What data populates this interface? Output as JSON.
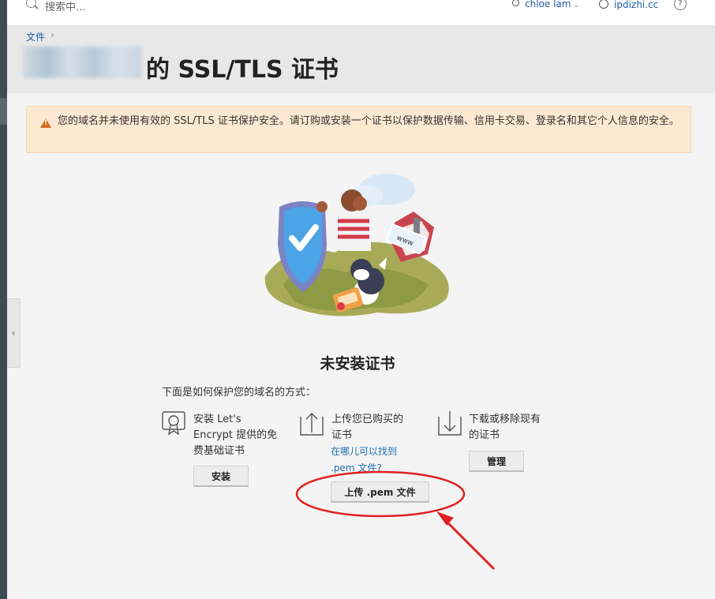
{
  "topbar": {
    "search_placeholder": "搜索中...",
    "user_name": "chloe lam",
    "domain_name": "ipdizhi.cc",
    "help_label": "?"
  },
  "breadcrumb": {
    "item": "文件",
    "separator": "›"
  },
  "page": {
    "title": "的 SSL/TLS 证书"
  },
  "warning": {
    "text": "您的域名并未使用有效的 SSL/TLS 证书保护安全。请订购或安装一个证书以保护数据传输、信用卡交易、登录名和其它个人信息的安全。",
    "color": "#fde9d2"
  },
  "empty_state": {
    "heading": "未安装证书",
    "subtitle": "下面是如何保护您的域名的方式："
  },
  "options": {
    "install": {
      "text_line1": "安装 Let's",
      "text_line2": "Encrypt 提供的免",
      "text_line3": "费基础证书",
      "button": "安装",
      "icon": "certificate-badge-icon"
    },
    "upload": {
      "text_line1": "上传您已购买的",
      "text_line2": "证书",
      "link_line1": "在哪儿可以找到",
      "link_line2": ".pem 文件?",
      "button": "上传 .pem 文件",
      "icon": "upload-arrow-icon"
    },
    "manage": {
      "text_line1": "下载或移除现有",
      "text_line2": "的证书",
      "button": "管理",
      "icon": "download-arrow-icon"
    }
  },
  "colors": {
    "link": "#1f5fa6",
    "annotation": "#e02020",
    "sidebar": "#3f4a52"
  }
}
